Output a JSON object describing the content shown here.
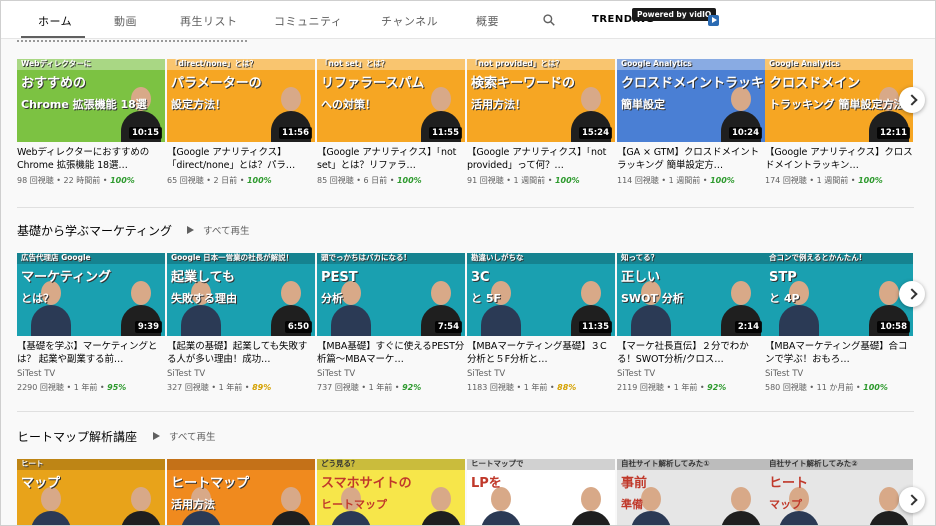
{
  "nav": {
    "tabs": [
      "ホーム",
      "動画",
      "再生リスト",
      "コミュニティ",
      "チャンネル",
      "概要"
    ],
    "trending": "TRENDING",
    "powered": "Powered by vidIQ"
  },
  "shelves": [
    {
      "title": "",
      "play_all": "",
      "videos": [
        {
          "thumb": {
            "bg": "#7cc242",
            "lines": [
              "Webディレクターに",
              "おすすめの",
              "Chrome 拡張機能 18選"
            ]
          },
          "duration": "10:15",
          "title": "Webディレクターにおすすめの Chrome 拡張機能 18選…",
          "channel": "",
          "views": "98 回視聴",
          "age": "22 時間前",
          "score": "100%"
        },
        {
          "thumb": {
            "bg": "#f6a623",
            "lines": [
              "「direct/none」とは？",
              "パラメーターの",
              "設定方法！"
            ]
          },
          "duration": "11:56",
          "title": "【Google アナリティクス】「direct/none」とは？パラ…",
          "channel": "",
          "views": "65 回視聴",
          "age": "2 日前",
          "score": "100%"
        },
        {
          "thumb": {
            "bg": "#f6a623",
            "lines": [
              "「not set」とは？",
              "リファラースパム",
              "への対策！"
            ]
          },
          "duration": "11:55",
          "title": "【Google アナリティクス】「not set」とは？リファラ…",
          "channel": "",
          "views": "85 回視聴",
          "age": "6 日前",
          "score": "100%"
        },
        {
          "thumb": {
            "bg": "#f6a623",
            "lines": [
              "「not provided」とは？",
              "検索キーワードの",
              "活用方法！"
            ]
          },
          "duration": "15:24",
          "title": "【Google アナリティクス】「not provided」って何？…",
          "channel": "",
          "views": "91 回視聴",
          "age": "1 週間前",
          "score": "100%"
        },
        {
          "thumb": {
            "bg": "#4a7fd4",
            "lines": [
              "Google Analytics",
              "クロスドメイントラッキング",
              "簡単設定"
            ]
          },
          "duration": "10:24",
          "title": "【GA × GTM】クロスドメイントラッキング 簡単設定方…",
          "channel": "",
          "views": "114 回視聴",
          "age": "1 週間前",
          "score": "100%"
        },
        {
          "thumb": {
            "bg": "#f6a623",
            "lines": [
              "Google Analytics",
              "クロスドメイン",
              "トラッキング 簡単設定方法"
            ]
          },
          "duration": "12:11",
          "title": "【Google アナリティクス】クロスドメイントラッキン…",
          "channel": "",
          "views": "174 回視聴",
          "age": "1 週間前",
          "score": "100%"
        }
      ]
    },
    {
      "title": "基礎から学ぶマーケティング",
      "play_all": "すべて再生",
      "videos": [
        {
          "thumb": {
            "bg": "#1aa0b0",
            "lines": [
              "広告代理店 Google",
              "マーケティング",
              "とは？"
            ]
          },
          "duration": "9:39",
          "title": "【基礎を学ぶ】マーケティングとは？ 起業や副業する前…",
          "channel": "SiTest TV",
          "views": "2290 回視聴",
          "age": "1 年前",
          "score": "95%"
        },
        {
          "thumb": {
            "bg": "#1aa0b0",
            "lines": [
              "Google 日本一営業の社長が解説！",
              "起業しても",
              "失敗する理由"
            ]
          },
          "duration": "6:50",
          "title": "【起業の基礎】起業しても失敗する人が多い理由！成功…",
          "channel": "SiTest TV",
          "views": "327 回視聴",
          "age": "1 年前",
          "score": "89%"
        },
        {
          "thumb": {
            "bg": "#1aa0b0",
            "lines": [
              "頭でっかちはバカになる!",
              "PEST",
              "分析"
            ]
          },
          "duration": "7:54",
          "title": "【MBA基礎】すぐに使えるPEST分析篇〜MBAマーケ…",
          "channel": "SiTest TV",
          "views": "737 回視聴",
          "age": "1 年前",
          "score": "92%"
        },
        {
          "thumb": {
            "bg": "#1aa0b0",
            "lines": [
              "勘違いしがちな",
              "3C",
              "と 5F"
            ]
          },
          "duration": "11:35",
          "title": "【MBAマーケティング基礎】３C分析と５F分析と…",
          "channel": "SiTest TV",
          "views": "1183 回視聴",
          "age": "1 年前",
          "score": "88%"
        },
        {
          "thumb": {
            "bg": "#1aa0b0",
            "lines": [
              "知ってる？",
              "正しい",
              "SWOT 分析"
            ]
          },
          "duration": "2:14",
          "title": "【マーケ社長直伝】２分でわかる！SWOT分析/クロス…",
          "channel": "SiTest TV",
          "views": "2119 回視聴",
          "age": "1 年前",
          "score": "92%"
        },
        {
          "thumb": {
            "bg": "#1aa0b0",
            "lines": [
              "合コンで例えるとかんたん!",
              "STP",
              "と 4P"
            ]
          },
          "duration": "10:58",
          "title": "【MBAマーケティング基礎】合コンで学ぶ！おもろ…",
          "channel": "SiTest TV",
          "views": "580 回視聴",
          "age": "11 か月前",
          "score": "100%"
        }
      ]
    },
    {
      "title": "ヒートマップ解析講座",
      "play_all": "すべて再生",
      "videos": [
        {
          "thumb": {
            "bg": "#e8a31a",
            "lines": [
              "ヒート",
              "マップ",
              ""
            ]
          }
        },
        {
          "thumb": {
            "bg": "#f08a1e",
            "lines": [
              "",
              "ヒートマップ",
              "活用方法"
            ]
          }
        },
        {
          "thumb": {
            "bg": "#f7e64a",
            "lines": [
              "どう見る？",
              "スマホサイトの",
              "ヒートマップ"
            ]
          }
        },
        {
          "thumb": {
            "bg": "#ffffff",
            "lines": [
              "ヒートマップで",
              "LPを",
              ""
            ]
          }
        },
        {
          "thumb": {
            "bg": "#e6e6e6",
            "lines": [
              "自社サイト解析してみた①",
              "事前",
              "準備"
            ]
          }
        },
        {
          "thumb": {
            "bg": "#e6e6e6",
            "lines": [
              "自社サイト解析してみた②",
              "ヒート",
              "マップ"
            ]
          }
        }
      ]
    }
  ]
}
